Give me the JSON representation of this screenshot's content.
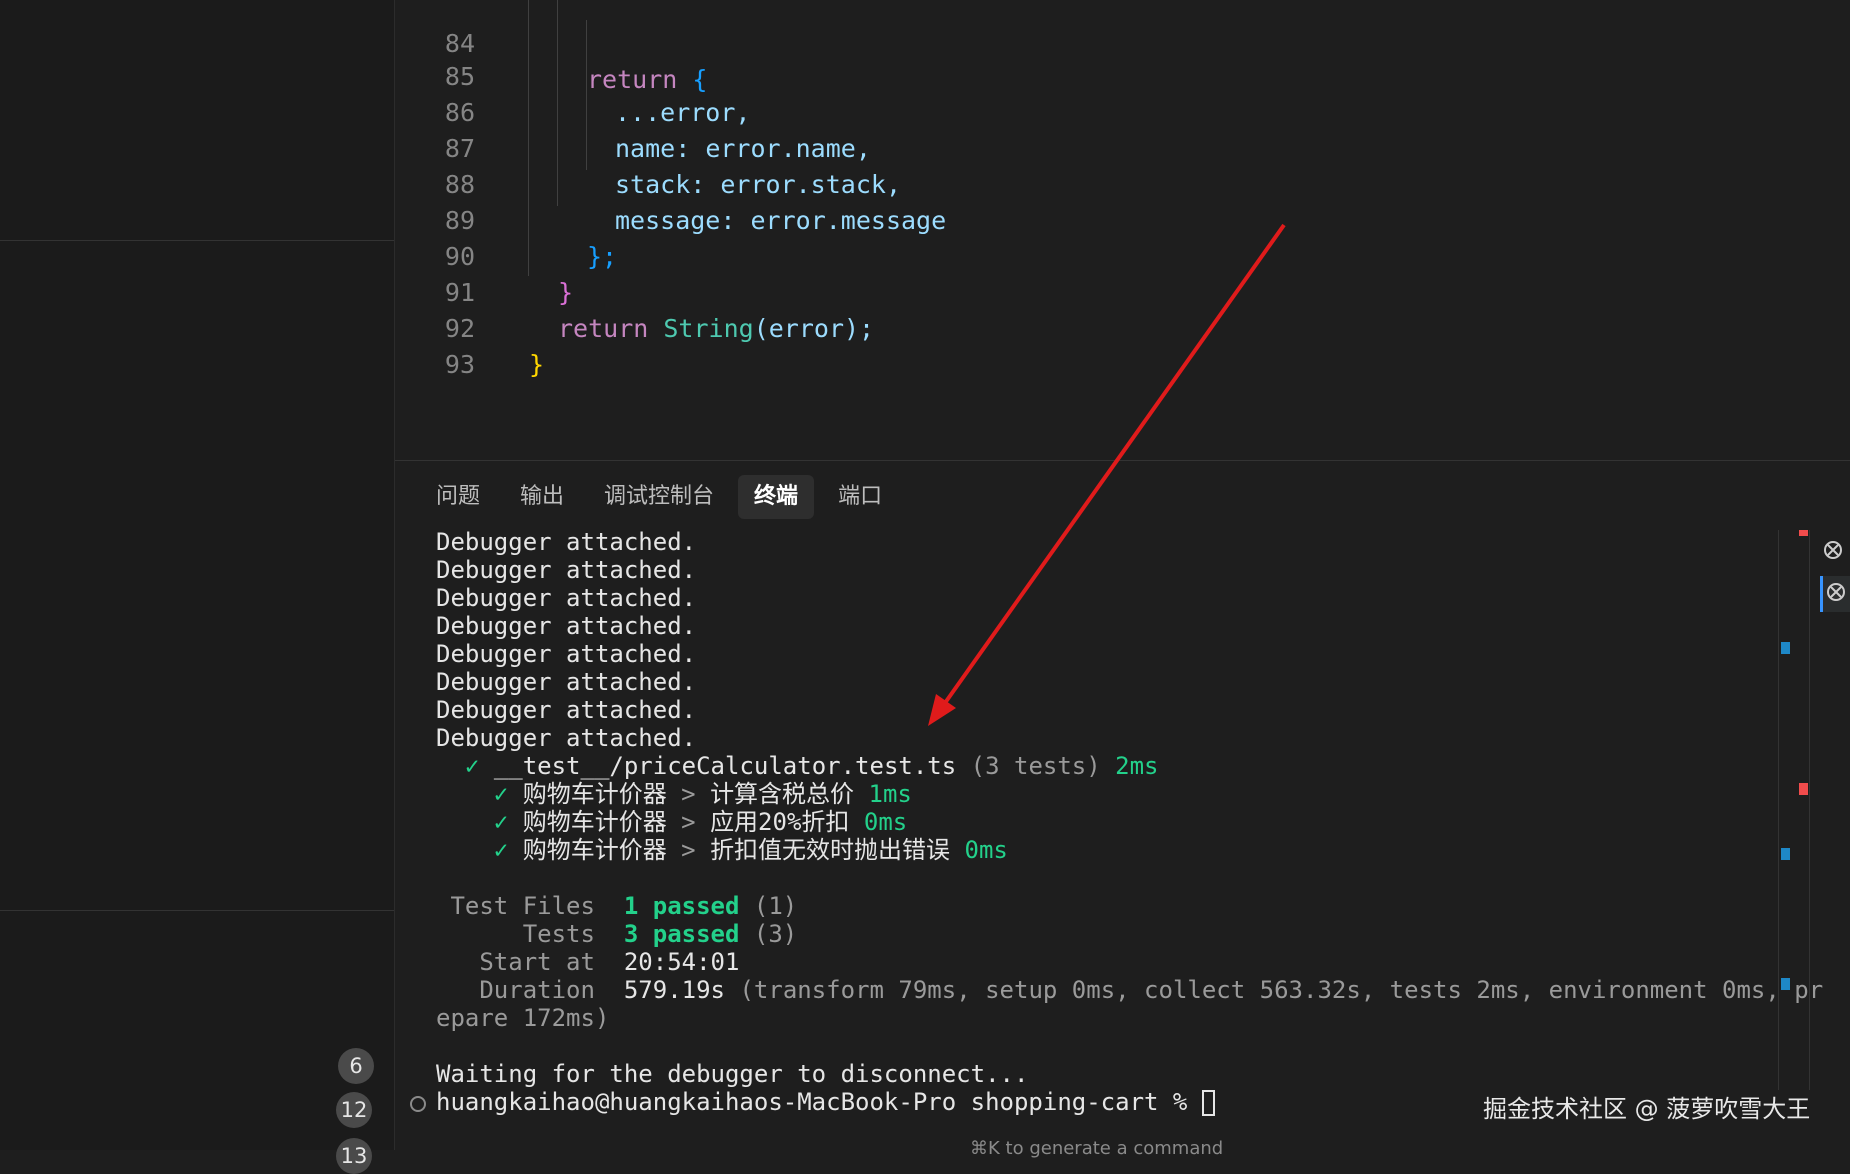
{
  "sidebar": {
    "badges": [
      "6",
      "12",
      "13"
    ]
  },
  "editor": {
    "lines": [
      {
        "num": "84",
        "kind": "return-open"
      },
      {
        "num": "85",
        "kind": "spread"
      },
      {
        "num": "86",
        "kind": "name"
      },
      {
        "num": "87",
        "kind": "stack"
      },
      {
        "num": "88",
        "kind": "message"
      },
      {
        "num": "89",
        "kind": "close-obj"
      },
      {
        "num": "90",
        "kind": "close-if"
      },
      {
        "num": "91",
        "kind": "return-string"
      },
      {
        "num": "92",
        "kind": "close-fn"
      },
      {
        "num": "93",
        "kind": "empty"
      }
    ],
    "tokens": {
      "return_kw": "return",
      "open_brace": "{",
      "spread": "...error,",
      "name_key": "name:",
      "name_val": "error.name,",
      "stack_key": "stack:",
      "stack_val": "error.stack,",
      "message_key": "message:",
      "message_val": "error.message",
      "close_obj": "};",
      "close_if": "}",
      "string_fn": "String",
      "string_args": "(error);",
      "close_fn": "}"
    }
  },
  "panel": {
    "tabs": [
      {
        "label": "问题",
        "active": false
      },
      {
        "label": "输出",
        "active": false
      },
      {
        "label": "调试控制台",
        "active": false
      },
      {
        "label": "终端",
        "active": true
      },
      {
        "label": "端口",
        "active": false
      }
    ]
  },
  "terminal": {
    "debugger_lines": [
      "Debugger attached.",
      "Debugger attached.",
      "Debugger attached.",
      "Debugger attached.",
      "Debugger attached.",
      "Debugger attached.",
      "Debugger attached.",
      "Debugger attached."
    ],
    "suite": {
      "check": "✓",
      "file": "__test__/priceCalculator.test.ts",
      "count": "(3 tests)",
      "time": "2ms"
    },
    "tests": [
      {
        "check": "✓",
        "group": "购物车计价器",
        "sep": ">",
        "name": "计算含税总价",
        "time": "1ms"
      },
      {
        "check": "✓",
        "group": "购物车计价器",
        "sep": ">",
        "name": "应用20%折扣",
        "time": "0ms"
      },
      {
        "check": "✓",
        "group": "购物车计价器",
        "sep": ">",
        "name": "折扣值无效时抛出错误",
        "time": "0ms"
      }
    ],
    "summary": {
      "files_label": " Test Files",
      "files_pass": "1 passed",
      "files_count": "(1)",
      "tests_label": "      Tests",
      "tests_pass": "3 passed",
      "tests_count": "(3)",
      "start_label": "   Start at",
      "start_value": "20:54:01",
      "duration_label": "   Duration",
      "duration_value": "579.19s",
      "duration_detail": "(transform 79ms, setup 0ms, collect 563.32s, tests 2ms, environment 0ms, pr",
      "duration_wrap": "epare 172ms)"
    },
    "waiting": "Waiting for the debugger to disconnect...",
    "prompt": "huangkaihao@huangkaihaos-MacBook-Pro shopping-cart %",
    "hint": "⌘K to generate a command"
  },
  "watermark": "掘金技术社区 @ 菠萝吹雪大王",
  "colors": {
    "annotation_arrow": "#e01b1b",
    "pass_green": "#23d18b"
  }
}
